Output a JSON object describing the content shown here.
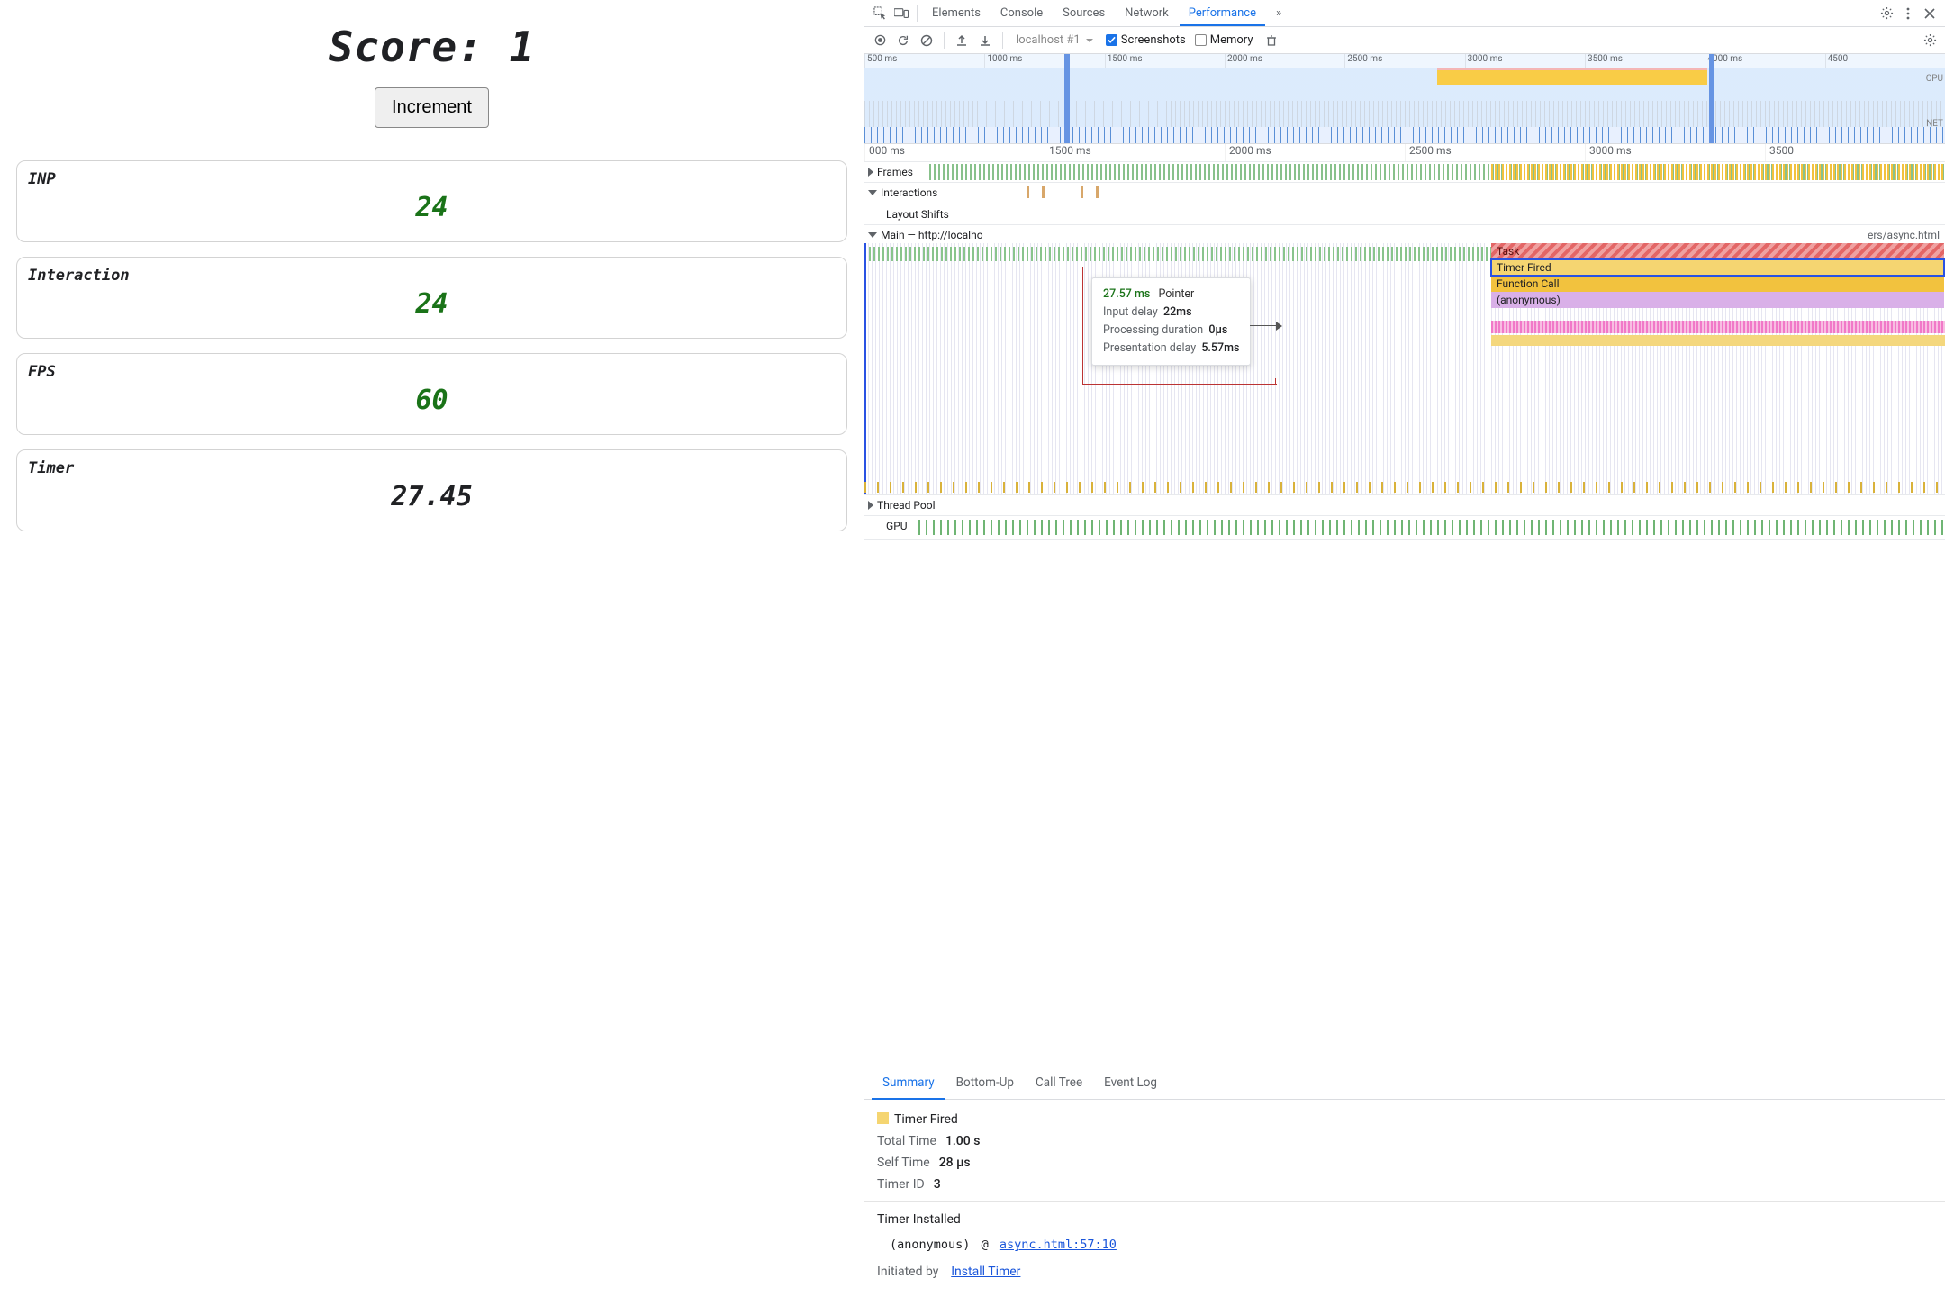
{
  "page": {
    "score_label": "Score:",
    "score_value": "1",
    "increment_label": "Increment",
    "metrics": {
      "inp": {
        "label": "INP",
        "value": "24"
      },
      "interaction": {
        "label": "Interaction",
        "value": "24"
      },
      "fps": {
        "label": "FPS",
        "value": "60"
      },
      "timer": {
        "label": "Timer",
        "value": "27.45"
      }
    }
  },
  "devtools": {
    "tabs": {
      "elements": "Elements",
      "console": "Console",
      "sources": "Sources",
      "network": "Network",
      "performance": "Performance",
      "more": "»"
    },
    "toolbar": {
      "recording_select": "localhost #1",
      "screenshots_label": "Screenshots",
      "memory_label": "Memory"
    },
    "overview": {
      "ticks": [
        "500 ms",
        "1000 ms",
        "1500 ms",
        "2000 ms",
        "2500 ms",
        "3000 ms",
        "3500 ms",
        "4000 ms",
        "4500"
      ],
      "side_labels": {
        "cpu": "CPU",
        "net": "NET"
      }
    },
    "flame": {
      "ruler": [
        "000 ms",
        "1500 ms",
        "2000 ms",
        "2500 ms",
        "3000 ms",
        "3500"
      ],
      "frames_label": "Frames",
      "interactions_label": "Interactions",
      "layoutshifts_label": "Layout Shifts",
      "main_label": "Main — http://localho",
      "main_suffix": "ers/async.html",
      "threadpool_label": "Thread Pool",
      "gpu_label": "GPU",
      "stack": {
        "task": "Task",
        "timer_fired": "Timer Fired",
        "function_call": "Function Call",
        "anonymous": "(anonymous)"
      }
    },
    "tooltip": {
      "header_time": "27.57 ms",
      "header_type": "Pointer",
      "rows": {
        "input_delay": {
          "k": "Input delay",
          "v": "22ms"
        },
        "processing": {
          "k": "Processing duration",
          "v": "0µs"
        },
        "presentation": {
          "k": "Presentation delay",
          "v": "5.57ms"
        }
      }
    },
    "detail_tabs": {
      "summary": "Summary",
      "bottomup": "Bottom-Up",
      "calltree": "Call Tree",
      "eventlog": "Event Log"
    },
    "details": {
      "title": "Timer Fired",
      "total_time": {
        "k": "Total Time",
        "v": "1.00 s"
      },
      "self_time": {
        "k": "Self Time",
        "v": "28 µs"
      },
      "timer_id": {
        "k": "Timer ID",
        "v": "3"
      }
    },
    "initiator": {
      "heading": "Timer Installed",
      "stack_fn": "(anonymous)",
      "stack_at": "@",
      "stack_loc": "async.html:57:10",
      "initiated_label": "Initiated by",
      "initiated_link": "Install Timer"
    }
  }
}
